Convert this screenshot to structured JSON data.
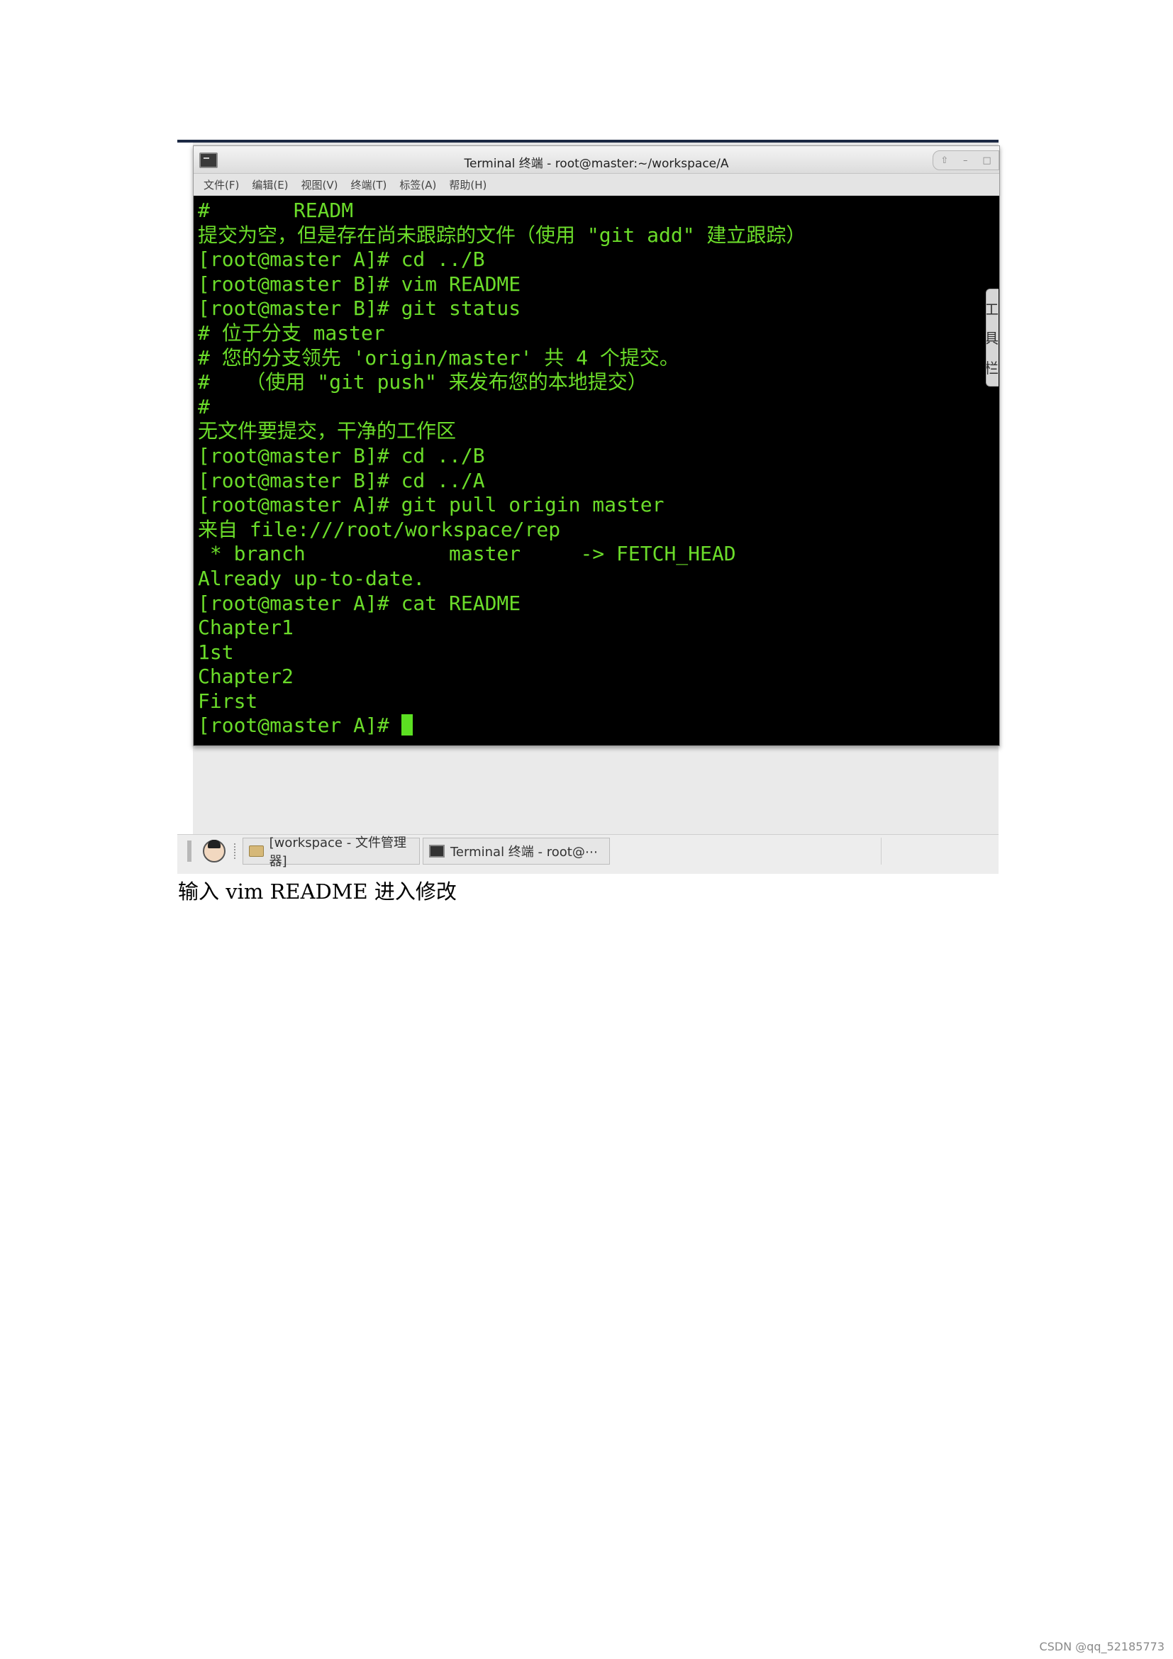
{
  "window": {
    "title": "Terminal 终端 - root@master:~/workspace/A",
    "controls": [
      "⇧",
      "–",
      "□"
    ]
  },
  "menu": [
    "文件(F)",
    "编辑(E)",
    "视图(V)",
    "终端(T)",
    "标签(A)",
    "帮助(H)"
  ],
  "terminal": {
    "lines": [
      "#       READM",
      "提交为空，但是存在尚未跟踪的文件（使用 \"git add\" 建立跟踪）",
      "[root@master A]# cd ../B",
      "[root@master B]# vim README",
      "[root@master B]# git status",
      "# 位于分支 master",
      "# 您的分支领先 'origin/master' 共 4 个提交。",
      "#   （使用 \"git push\" 来发布您的本地提交）",
      "#",
      "无文件要提交，干净的工作区",
      "[root@master B]# cd ../B",
      "[root@master B]# cd ../A",
      "[root@master A]# git pull origin master",
      "来自 file:///root/workspace/rep",
      " * branch            master     -> FETCH_HEAD",
      "Already up-to-date.",
      "[root@master A]# cat README",
      "Chapter1",
      "1st",
      "Chapter2",
      "First"
    ],
    "prompt": "[root@master A]# "
  },
  "side_tab": [
    "工",
    "具",
    "栏"
  ],
  "taskbar": {
    "items": [
      {
        "label": "[workspace - 文件管理器]"
      },
      {
        "label": "Terminal 终端 - root@⋯"
      }
    ]
  },
  "caption": "输入 vim README 进入修改",
  "watermark": "CSDN @qq_52185773"
}
